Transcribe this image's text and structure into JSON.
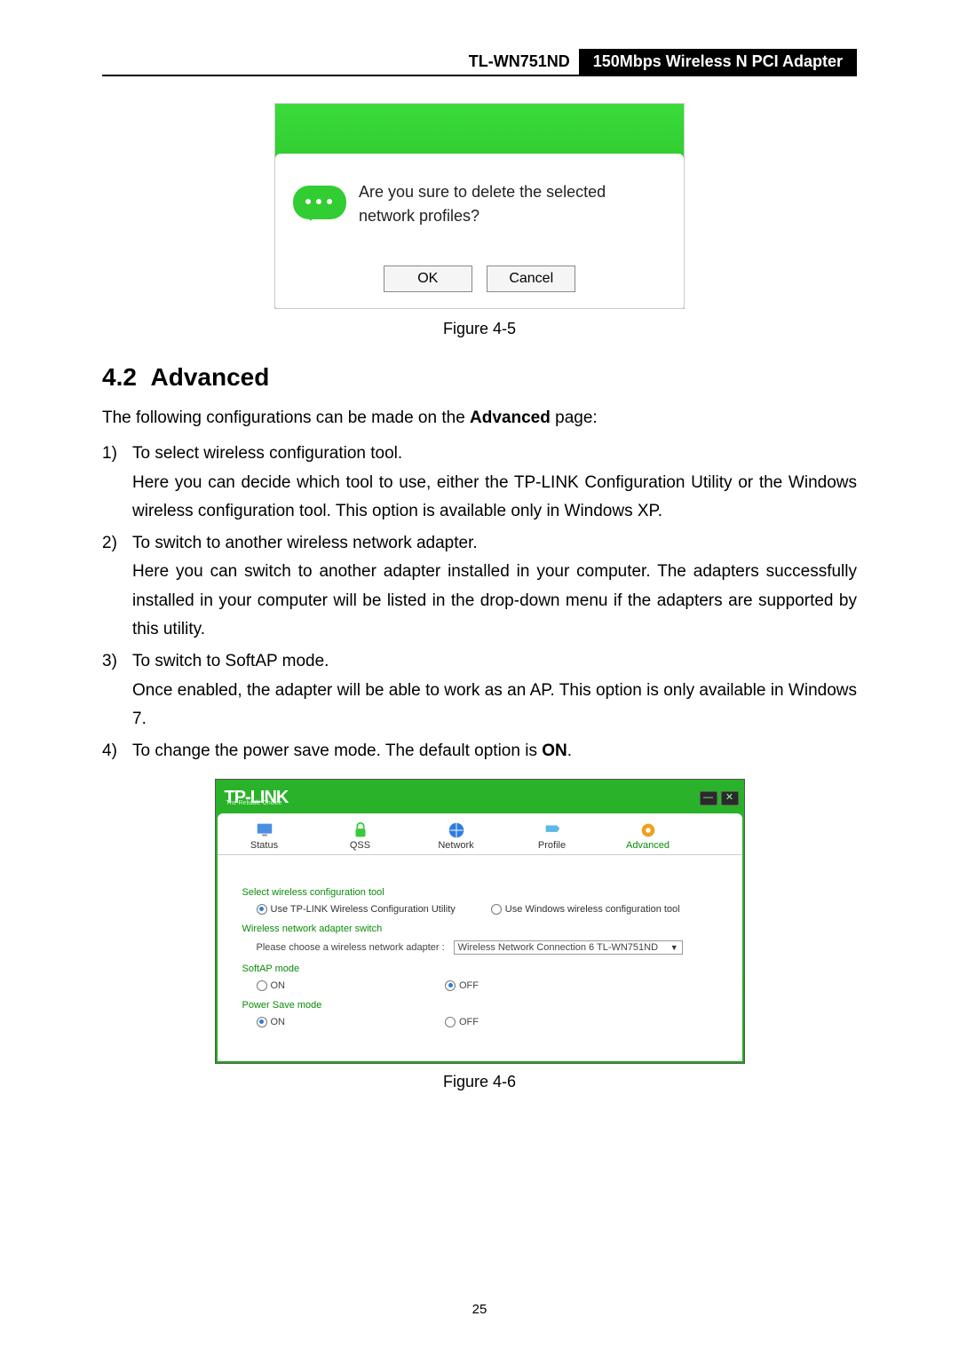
{
  "header": {
    "model": "TL-WN751ND",
    "product": "150Mbps Wireless N PCI Adapter"
  },
  "dialog": {
    "message": "Are you sure to delete the selected network profiles?",
    "ok": "OK",
    "cancel": "Cancel",
    "caption": "Figure 4-5"
  },
  "section": {
    "number": "4.2",
    "title": "Advanced"
  },
  "intro_pre": "The following configurations can be made on the ",
  "intro_bold": "Advanced",
  "intro_post": " page:",
  "items": [
    {
      "n": "1)",
      "lead": "To select wireless configuration tool.",
      "body": "Here you can decide which tool to use, either the TP-LINK Configuration Utility or the Windows wireless configuration tool. This option is available only in Windows XP."
    },
    {
      "n": "2)",
      "lead": "To switch to another wireless network adapter.",
      "body": "Here you can switch to another adapter installed in your computer. The adapters successfully installed in your computer will be listed in the drop-down menu if the adapters are supported by this utility."
    },
    {
      "n": "3)",
      "lead": "To switch to SoftAP mode.",
      "body": "Once enabled, the adapter will be able to work as an AP. This option is only available in Windows 7."
    },
    {
      "n": "4)",
      "lead_pre": "To change the power save mode. The default option is ",
      "lead_bold": "ON",
      "lead_post": "."
    }
  ],
  "app": {
    "brand": "TP-LINK",
    "brand_sub": "The Reliable Choice",
    "tabs": [
      "Status",
      "QSS",
      "Network",
      "Profile",
      "Advanced"
    ],
    "sel_tool_lbl": "Select wireless configuration tool",
    "tool_opt1": "Use TP-LINK Wireless Configuration Utility",
    "tool_opt2": "Use Windows wireless configuration tool",
    "adapter_lbl": "Wireless network adapter switch",
    "adapter_prompt": "Please choose a wireless network adapter :",
    "adapter_value": "Wireless Network Connection 6  TL-WN751ND",
    "softap_lbl": "SoftAP mode",
    "on": "ON",
    "off": "OFF",
    "power_lbl": "Power Save mode",
    "caption": "Figure 4-6"
  },
  "page_number": "25"
}
